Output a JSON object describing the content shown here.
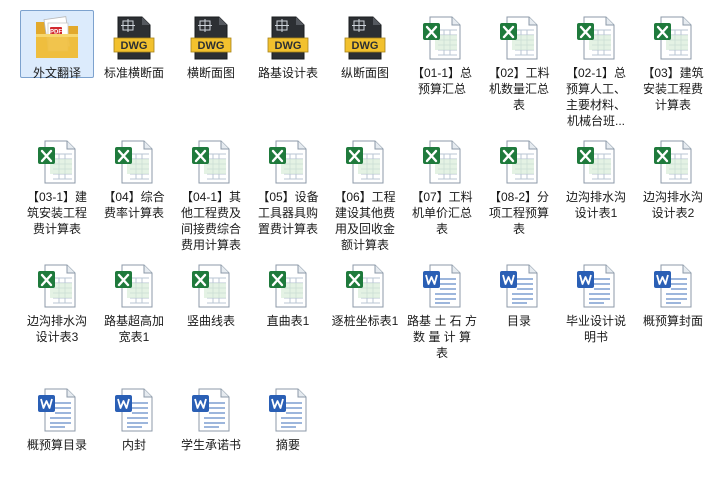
{
  "files": [
    {
      "name": "外文翻译",
      "type": "pdf-folder",
      "selected": true
    },
    {
      "name": "标准横断面",
      "type": "dwg"
    },
    {
      "name": "横断面图",
      "type": "dwg"
    },
    {
      "name": "路基设计表",
      "type": "dwg"
    },
    {
      "name": "纵断面图",
      "type": "dwg"
    },
    {
      "name": "【01-1】总预算汇总",
      "type": "excel"
    },
    {
      "name": "【02】工料机数量汇总表",
      "type": "excel"
    },
    {
      "name": "【02-1】总预算人工、主要材料、机械台班...",
      "type": "excel"
    },
    {
      "name": "【03】建筑安装工程费计算表",
      "type": "excel"
    },
    {
      "name": "【03-1】建筑安装工程费计算表",
      "type": "excel"
    },
    {
      "name": "【04】综合费率计算表",
      "type": "excel"
    },
    {
      "name": "【04-1】其他工程费及间接费综合费用计算表",
      "type": "excel"
    },
    {
      "name": "【05】设备工具器具购置费计算表",
      "type": "excel"
    },
    {
      "name": "【06】工程建设其他费用及回收金额计算表",
      "type": "excel"
    },
    {
      "name": "【07】工料机单价汇总表",
      "type": "excel"
    },
    {
      "name": "【08-2】分项工程预算表",
      "type": "excel"
    },
    {
      "name": "边沟排水沟设计表1",
      "type": "excel"
    },
    {
      "name": "边沟排水沟设计表2",
      "type": "excel"
    },
    {
      "name": "边沟排水沟设计表3",
      "type": "excel"
    },
    {
      "name": "路基超高加宽表1",
      "type": "excel"
    },
    {
      "name": "竖曲线表",
      "type": "excel"
    },
    {
      "name": "直曲表1",
      "type": "excel"
    },
    {
      "name": "逐桩坐标表1",
      "type": "excel"
    },
    {
      "name": "路基 土 石 方 数 量 计 算 表",
      "type": "word"
    },
    {
      "name": "目录",
      "type": "word"
    },
    {
      "name": "毕业设计说明书",
      "type": "word"
    },
    {
      "name": "概预算封面",
      "type": "word"
    },
    {
      "name": "概预算目录",
      "type": "word"
    },
    {
      "name": "内封",
      "type": "word"
    },
    {
      "name": "学生承诺书",
      "type": "word"
    },
    {
      "name": "摘要",
      "type": "word"
    }
  ],
  "icon_colors": {
    "excel": "#1f7a3c",
    "word": "#2a5fb5",
    "dwg_label": "#f2c12e",
    "pdf": "#d2282e",
    "folder": "#f0c040"
  }
}
